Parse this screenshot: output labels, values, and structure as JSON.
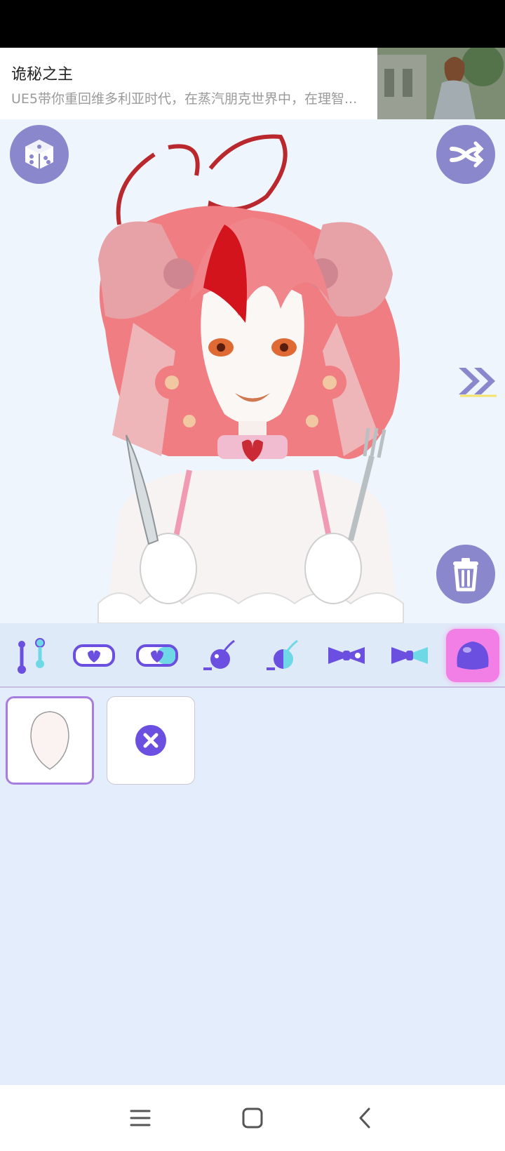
{
  "ad": {
    "title": "诡秘之主",
    "description": "UE5带你重回维多利亚时代，在蒸汽朋克世界中，在理智..."
  },
  "canvas": {
    "background": "#eef5fd",
    "buttons": {
      "random": "dice-icon",
      "shuffle": "shuffle-icon",
      "delete": "trash-icon",
      "next": "double-chevron-right-icon"
    }
  },
  "toolbar": {
    "categories": [
      {
        "icon": "body-pose-icon"
      },
      {
        "icon": "heart-mask-icon"
      },
      {
        "icon": "heart-mask-color-icon"
      },
      {
        "icon": "bomb-icon"
      },
      {
        "icon": "bomb-color-icon"
      },
      {
        "icon": "bow-icon"
      },
      {
        "icon": "bow-color-icon"
      },
      {
        "icon": "head-shape-icon",
        "active": true
      }
    ],
    "accent": "#6b4fe0",
    "active_color": "#f27fe6"
  },
  "options": [
    {
      "icon": "face-base-icon",
      "selected": true
    },
    {
      "icon": "none-icon",
      "selected": false
    }
  ],
  "nav": {
    "icons": [
      "menu-icon",
      "home-icon",
      "back-icon"
    ]
  }
}
